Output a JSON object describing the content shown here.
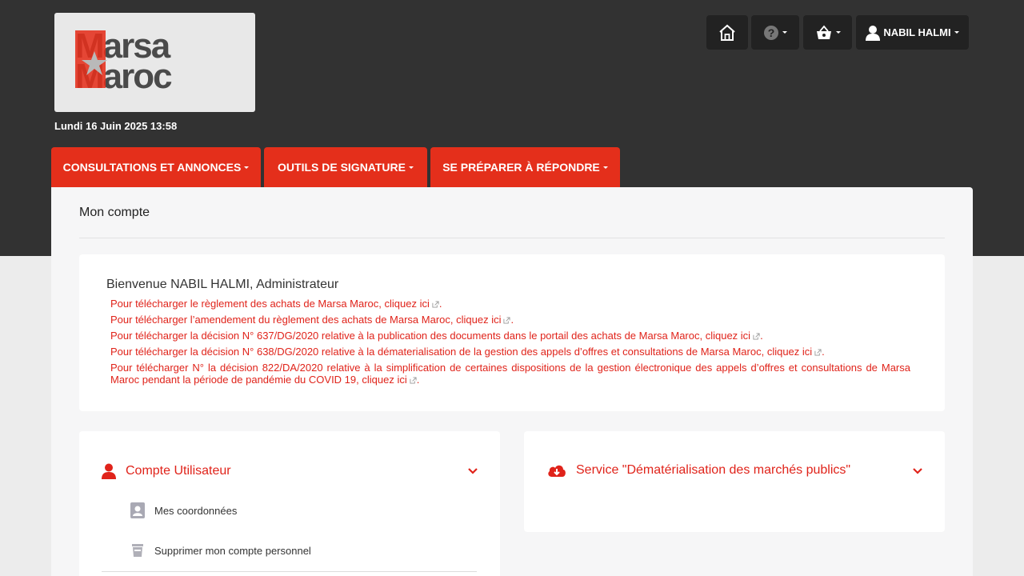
{
  "brand": {
    "logo_line1": "Marsa",
    "logo_line2": "Maroc",
    "accent": "#e42f1b",
    "dark": "#323232"
  },
  "datetime": "Lundi 16 Juin 2025 13:58",
  "topbar": {
    "home_icon": "home-icon",
    "help_icon": "question-circle-icon",
    "basket_icon": "basket-icon",
    "user_icon": "user-icon",
    "user_name": "NABIL HALMI"
  },
  "nav": {
    "tabs": [
      {
        "label": "CONSULTATIONS ET ANNONCES"
      },
      {
        "label": "OUTILS DE SIGNATURE"
      },
      {
        "label": "SE PRÉPARER À RÉPONDRE"
      }
    ]
  },
  "main": {
    "heading": "Mon compte",
    "welcome": "Bienvenue NABIL HALMI, Administrateur",
    "links": [
      {
        "text": "Pour télécharger le règlement des achats de Marsa Maroc, ",
        "link": "cliquez ici",
        "after": "."
      },
      {
        "text": "Pour télécharger l’amendement du règlement des achats de Marsa Maroc, ",
        "link": "cliquez ici",
        "after": "."
      },
      {
        "text": "Pour télécharger la décision N° 637/DG/2020 relative à la publication des documents dans le portail des achats de Marsa Maroc, ",
        "link": "cliquez ici",
        "after": "."
      },
      {
        "text": "Pour télécharger la décision N° 638/DG/2020 relative à la dématerialisation de la gestion des appels d’offres et consultations de Marsa Maroc, ",
        "link": "cliquez ici",
        "after": "."
      },
      {
        "text": "Pour télécharger N° la décision 822/DA/2020 relative à la simplification de certaines dispositions de la gestion électronique des appels d’offres et consultations de Marsa Maroc pendant la période de pandémie du COVID 19, ",
        "link": "cliquez ici",
        "after": "."
      }
    ]
  },
  "account_card": {
    "title": "Compte Utilisateur",
    "items": [
      {
        "label": "Mes coordonnées",
        "icon": "contact-card-icon"
      },
      {
        "label": "Supprimer mon compte personnel",
        "icon": "trash-icon"
      }
    ]
  },
  "service_card": {
    "title": "Service \"Dématérialisation des marchés publics\"",
    "icon": "cloud-download-icon"
  }
}
